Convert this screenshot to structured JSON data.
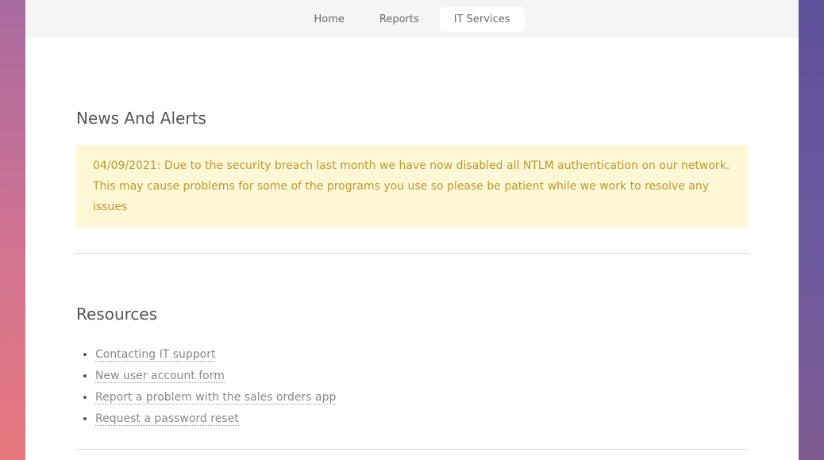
{
  "nav": {
    "items": [
      {
        "label": "Home"
      },
      {
        "label": "Reports"
      },
      {
        "label": "IT Services"
      }
    ]
  },
  "news": {
    "heading": "News And Alerts",
    "alert_text": "04/09/2021: Due to the security breach last month we have now disabled all NTLM authentication on our network. This may cause problems for some of the programs you use so please be patient while we work to resolve any issues"
  },
  "resources": {
    "heading": "Resources",
    "links": [
      {
        "label": "Contacting IT support"
      },
      {
        "label": "New user account form"
      },
      {
        "label": "Report a problem with the sales orders app"
      },
      {
        "label": "Request a password reset"
      }
    ]
  },
  "colors": {
    "alert_background": "#fff7d6",
    "alert_text": "#bd9a2c"
  }
}
